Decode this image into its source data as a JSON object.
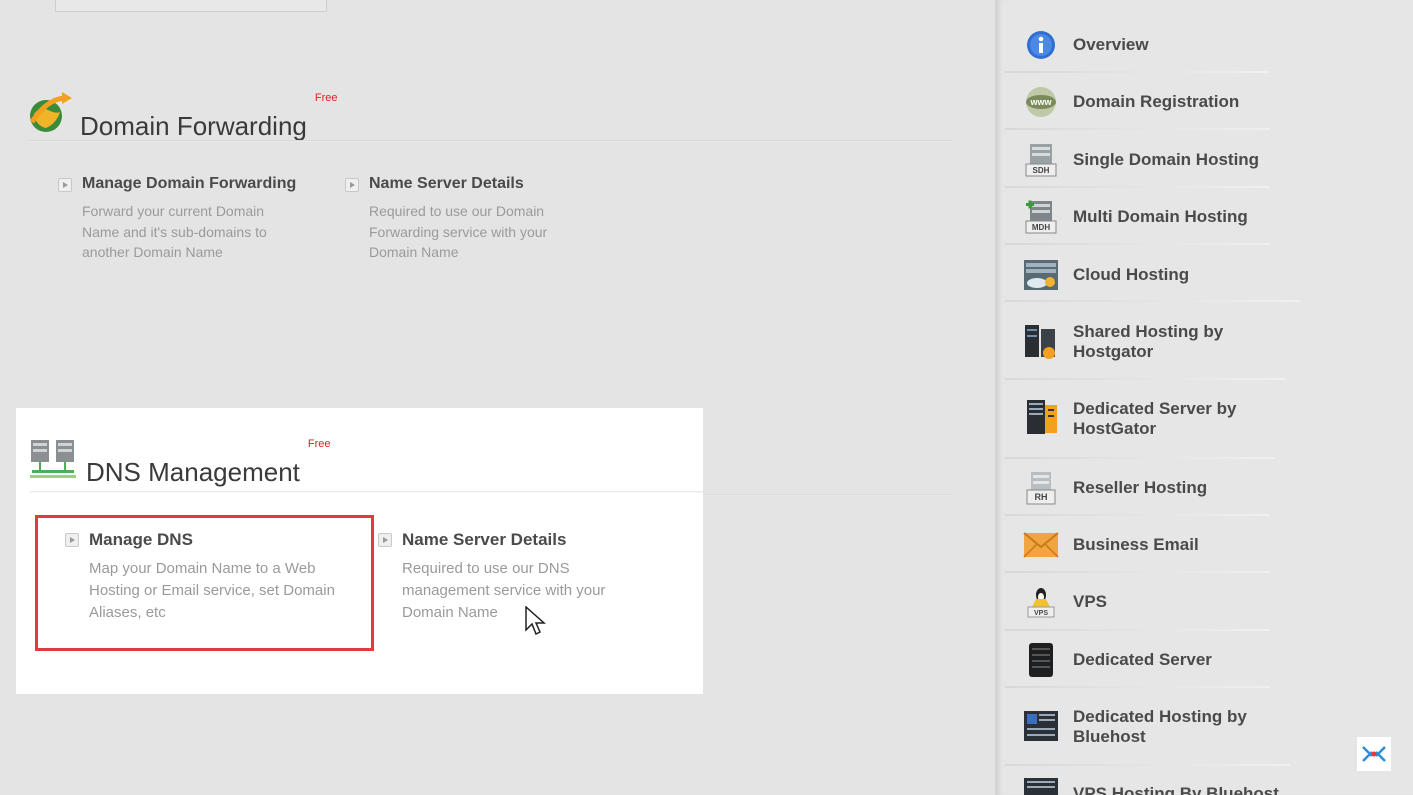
{
  "domain_forwarding": {
    "title": "Domain Forwarding",
    "badge": "Free",
    "items": [
      {
        "title": "Manage Domain Forwarding",
        "desc": "Forward your current Domain Name and it's sub-domains to another Domain Name"
      },
      {
        "title": "Name Server Details",
        "desc": "Required to use our Domain Forwarding service with your Domain Name"
      }
    ]
  },
  "dns_management": {
    "title": "DNS Management",
    "badge": "Free",
    "items": [
      {
        "title": "Manage DNS",
        "desc": "Map your Domain Name to a Web Hosting or Email service, set Domain Aliases, etc"
      },
      {
        "title": "Name Server Details",
        "desc": "Required to use our DNS management service with your Domain Name"
      }
    ]
  },
  "sidebar": {
    "items": [
      {
        "label": "Overview",
        "icon": "info-icon"
      },
      {
        "label": "Domain Registration",
        "icon": "www-globe-icon"
      },
      {
        "label": "Single Domain Hosting",
        "icon": "sdh-server-icon",
        "tag": "SDH"
      },
      {
        "label": "Multi Domain Hosting",
        "icon": "mdh-server-icon",
        "tag": "MDH"
      },
      {
        "label": "Cloud Hosting",
        "icon": "cloud-hosting-icon"
      },
      {
        "label": "Shared Hosting by Hostgator",
        "icon": "hostgator-server-icon"
      },
      {
        "label": "Dedicated Server by HostGator",
        "icon": "hostgator-rack-icon"
      },
      {
        "label": "Reseller Hosting",
        "icon": "rh-server-icon",
        "tag": "RH"
      },
      {
        "label": "Business Email",
        "icon": "envelope-icon"
      },
      {
        "label": "VPS",
        "icon": "vps-linux-icon",
        "tag": "VPS"
      },
      {
        "label": "Dedicated Server",
        "icon": "server-tower-icon"
      },
      {
        "label": "Dedicated Hosting by Bluehost",
        "icon": "bluehost-server-icon"
      },
      {
        "label": "VPS Hosting By Bluehost",
        "icon": "bluehost-vps-icon"
      }
    ]
  },
  "colors": {
    "highlight": "#e23b3b",
    "free_badge": "#e02020"
  }
}
